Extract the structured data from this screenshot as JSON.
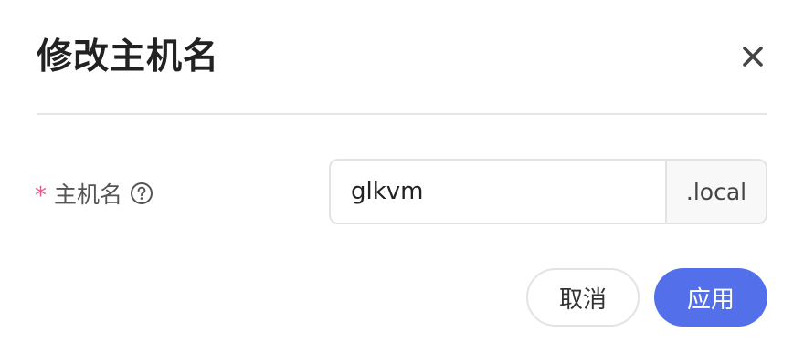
{
  "dialog": {
    "title": "修改主机名",
    "close_icon": "close-icon"
  },
  "form": {
    "hostname": {
      "label": "主机名",
      "required_mark": "*",
      "help_icon": "question-circle-icon",
      "value": "glkvm",
      "suffix": ".local"
    }
  },
  "actions": {
    "cancel_label": "取消",
    "apply_label": "应用"
  },
  "colors": {
    "accent": "#5370ea",
    "required": "#e05a86"
  }
}
